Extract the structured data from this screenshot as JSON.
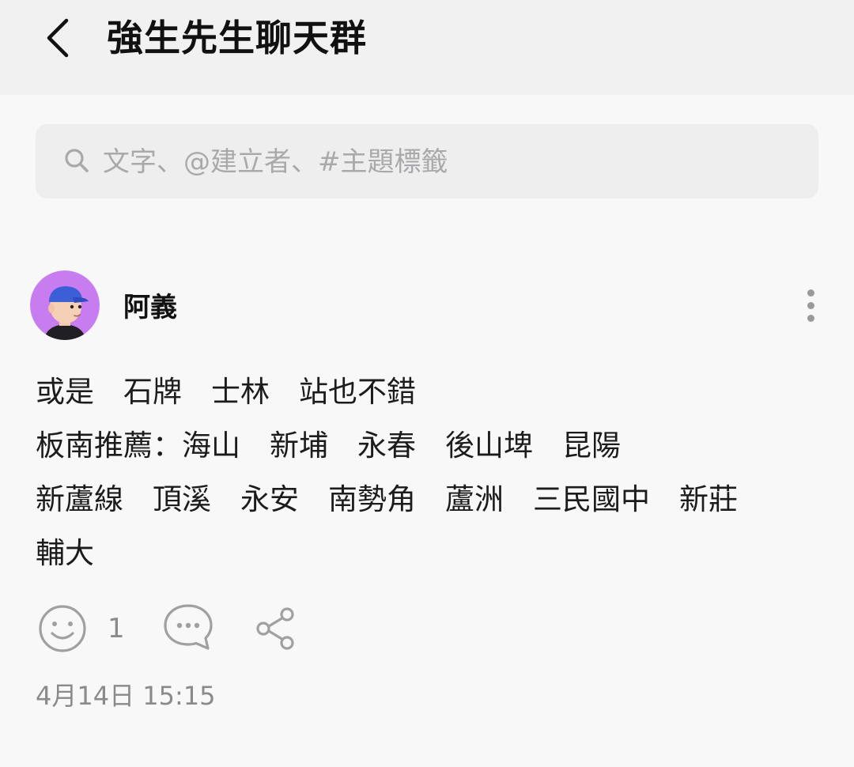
{
  "header": {
    "back_icon": "chevron-left-icon",
    "title": "強生先生聊天群"
  },
  "search": {
    "icon": "search-icon",
    "placeholder": "文字、@建立者、#主題標籤",
    "value": ""
  },
  "post": {
    "avatar": "avatar-icon",
    "author": "阿義",
    "more_icon": "more-vertical-icon",
    "content": "或是　石牌　士林　站也不錯\n板南推薦：海山　新埔　永春　後山埤　昆陽\n新蘆線　頂溪　永安　南勢角　蘆洲　三民國中　新莊　輔大",
    "reaction_icon": "smiley-icon",
    "reaction_count": "1",
    "comment_icon": "comment-bubble-icon",
    "share_icon": "share-icon",
    "timestamp": "4月14日 15:15"
  },
  "colors": {
    "background": "#f8f8f9",
    "header_bg": "#f1f1f2",
    "search_bg": "#eeeeef",
    "avatar_bg": "#c77df0",
    "icon_gray": "#9a9a9c"
  }
}
